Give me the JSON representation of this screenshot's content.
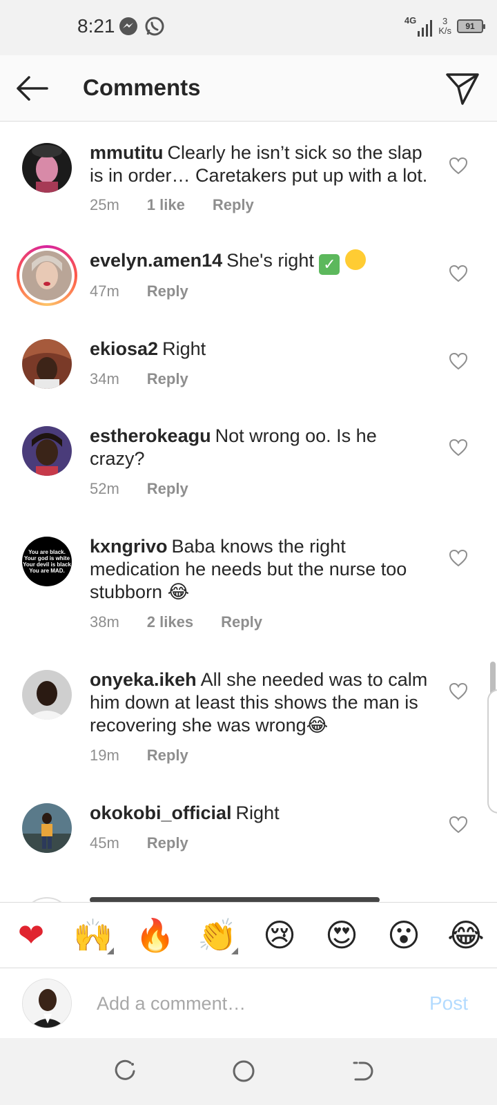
{
  "status_bar": {
    "time": "8:21",
    "network": "4G",
    "speed_value": "3",
    "speed_unit": "K/s",
    "battery": "91"
  },
  "header": {
    "title": "Comments"
  },
  "comments": [
    {
      "username": "mmutitu",
      "text": "Clearly he isn’t sick so the slap is in order… Caretakers put up with a lot.",
      "time": "25m",
      "likes": "1 like",
      "reply": "Reply"
    },
    {
      "username": "evelyn.amen14",
      "text": "She's right",
      "time": "47m",
      "likes": "",
      "reply": "Reply"
    },
    {
      "username": "ekiosa2",
      "text": "Right",
      "time": "34m",
      "likes": "",
      "reply": "Reply"
    },
    {
      "username": "estherokeagu",
      "text": "Not wrong oo. Is he crazy?",
      "time": "52m",
      "likes": "",
      "reply": "Reply"
    },
    {
      "username": "kxngrivo",
      "text": "Baba knows the right medication he needs but the nurse too stubborn 😂",
      "time": "38m",
      "likes": "2 likes",
      "reply": "Reply",
      "avatar_text": [
        "You are black.",
        "Your god is white",
        "Your devil is black",
        "You are MAD."
      ]
    },
    {
      "username": "onyeka.ikeh",
      "text": "All she needed was to calm him down at least this shows the man is recovering she was wrong😂",
      "time": "19m",
      "likes": "",
      "reply": "Reply"
    },
    {
      "username": "okokobi_official",
      "text": "Right",
      "time": "45m",
      "likes": "",
      "reply": "Reply"
    }
  ],
  "emoji_bar": [
    "❤",
    "🙌",
    "🔥",
    "👏",
    "😢",
    "😍",
    "😮",
    "😂"
  ],
  "composer": {
    "placeholder": "Add a comment…",
    "post_label": "Post"
  },
  "colors": {
    "accent": "#0095f6",
    "post_disabled": "#b3dbff",
    "meta": "#8e8e8e"
  }
}
